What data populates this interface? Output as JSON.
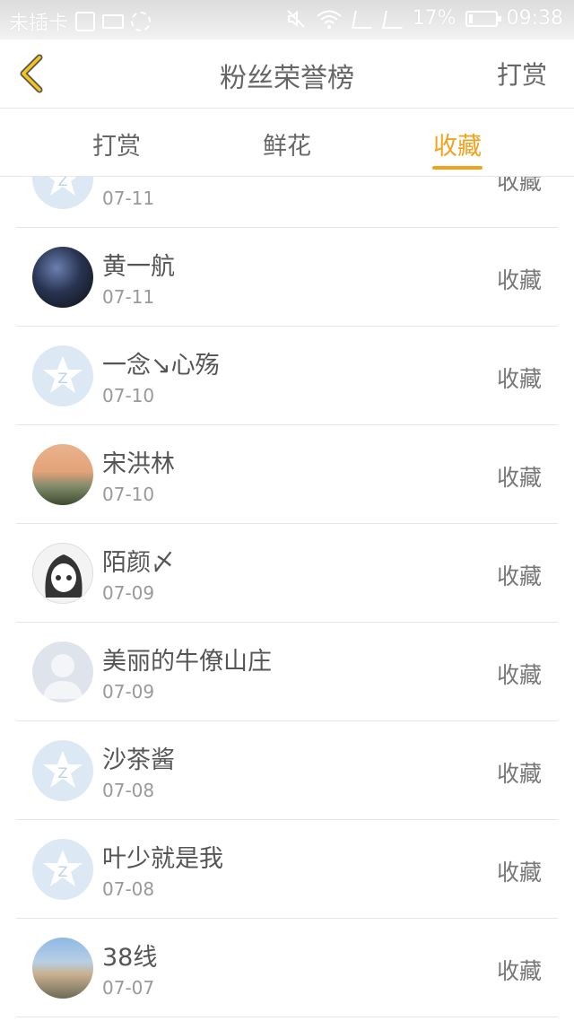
{
  "status_bar": {
    "carrier": "未插卡",
    "battery_percent": "17%",
    "time": "09:38",
    "battery_level": 0.17,
    "icons": [
      "image-icon",
      "keyboard-icon",
      "sync-icon",
      "mute-icon",
      "wifi-icon",
      "sim1-no-signal-icon",
      "sim2-no-signal-icon",
      "battery-icon"
    ]
  },
  "header": {
    "back_icon": "chevron-left-icon",
    "title": "粉丝荣誉榜",
    "action": "打赏"
  },
  "tabs": [
    {
      "label": "打赏",
      "active": false
    },
    {
      "label": "鲜花",
      "active": false
    },
    {
      "label": "收藏",
      "active": true
    }
  ],
  "accent_color": "#f0a31e",
  "list": [
    {
      "name": "",
      "date": "07-11",
      "action": "收藏",
      "avatar": "qq-default-icon"
    },
    {
      "name": "黄一航",
      "date": "07-11",
      "action": "收藏",
      "avatar": "game-hero-avatar"
    },
    {
      "name": "一念↘心殇",
      "date": "07-10",
      "action": "收藏",
      "avatar": "qq-default-icon"
    },
    {
      "name": "宋洪林",
      "date": "07-10",
      "action": "收藏",
      "avatar": "castle-photo-avatar"
    },
    {
      "name": "陌颜〆",
      "date": "07-09",
      "action": "收藏",
      "avatar": "anime-girl-avatar"
    },
    {
      "name": "美丽的牛僚山庄",
      "date": "07-09",
      "action": "收藏",
      "avatar": "default-person-avatar"
    },
    {
      "name": "沙茶酱",
      "date": "07-08",
      "action": "收藏",
      "avatar": "qq-default-icon"
    },
    {
      "name": "叶少就是我",
      "date": "07-08",
      "action": "收藏",
      "avatar": "qq-default-icon"
    },
    {
      "name": "38线",
      "date": "07-07",
      "action": "收藏",
      "avatar": "town-photo-avatar"
    }
  ]
}
